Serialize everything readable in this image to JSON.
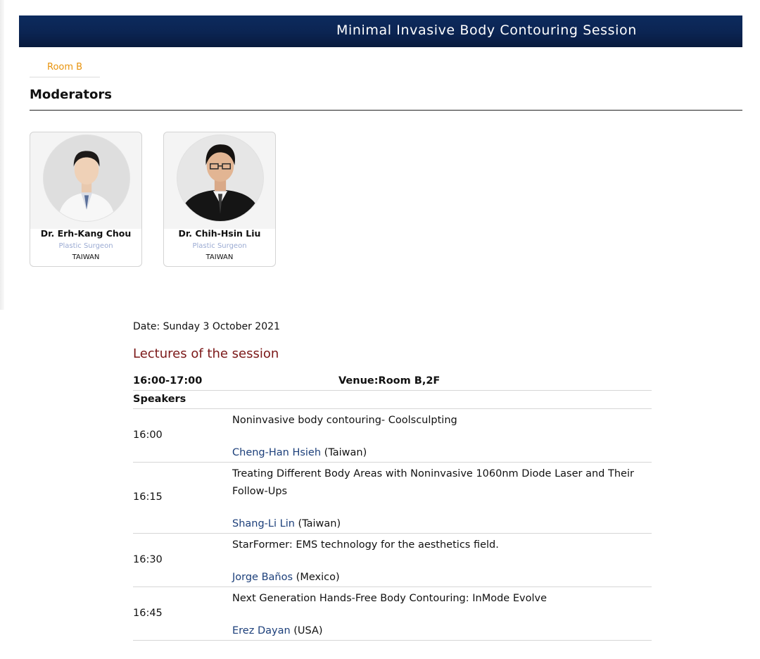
{
  "session": {
    "title": "Minimal Invasive Body Contouring Session",
    "room": "Room B"
  },
  "moderators": {
    "heading": "Moderators",
    "people": [
      {
        "name": "Dr. Erh-Kang Chou",
        "role": "Plastic Surgeon",
        "country": "TAIWAN"
      },
      {
        "name": "Dr. Chih-Hsin Liu",
        "role": "Plastic Surgeon",
        "country": "TAIWAN"
      }
    ]
  },
  "schedule": {
    "date": "Date: Sunday 3 October 2021",
    "lectures_heading": "Lectures of the session",
    "time_range": "16:00-17:00",
    "venue": "Venue:Room B,2F",
    "speakers_label": "Speakers",
    "lectures": [
      {
        "time": "16:00",
        "title": "Noninvasive body contouring- Coolsculpting",
        "speaker": "Cheng-Han Hsieh",
        "country": "(Taiwan)"
      },
      {
        "time": "16:15",
        "title": "Treating Different Body Areas with Noninvasive 1060nm Diode Laser and Their Follow-Ups",
        "speaker": "Shang-Li Lin",
        "country": "(Taiwan)"
      },
      {
        "time": "16:30",
        "title": "StarFormer: EMS technology for the aesthetics field.",
        "speaker": "Jorge Baños",
        "country": "(Mexico)"
      },
      {
        "time": "16:45",
        "title": "Next Generation Hands-Free Body Contouring: InMode Evolve",
        "speaker": "Erez Dayan",
        "country": "(USA)"
      }
    ]
  },
  "colors": {
    "banner": "#0b2452",
    "room_tab": "#e8930c",
    "lectures_heading": "#7b1818",
    "role": "#9aaad2",
    "speaker_name": "#1c3f7a"
  }
}
